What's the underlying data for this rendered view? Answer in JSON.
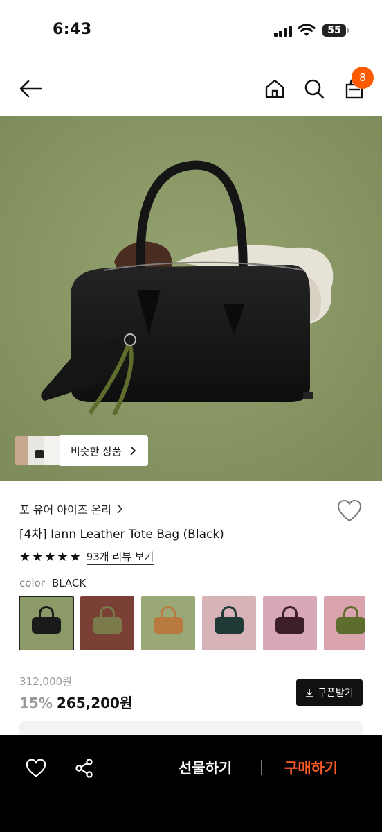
{
  "status_bar": {
    "time": "6:43",
    "battery": "55"
  },
  "header": {
    "back_icon": "arrow-left-icon",
    "home_icon": "home-icon",
    "search_icon": "search-icon",
    "cart_icon": "shopping-bag-icon",
    "cart_count": "8"
  },
  "hero": {
    "similar_label": "비슷한 상품"
  },
  "product": {
    "brand": "포 유어 아이즈 온리",
    "title": "[4차] Iann Leather Tote Bag (Black)",
    "rating_stars": 5,
    "review_link": "93개 리뷰 보기",
    "color_label": "color",
    "color_value": "BLACK",
    "swatches": [
      {
        "color": "#1a1a1a",
        "bg": "#8c9a68"
      },
      {
        "color": "#7a7a4a",
        "bg": "#7a3f35"
      },
      {
        "color": "#b87a3e",
        "bg": "#9aa878"
      },
      {
        "color": "#1f3a36",
        "bg": "#d7b3b7"
      },
      {
        "color": "#3d1f2a",
        "bg": "#d8a8b8"
      },
      {
        "color": "#5e6d2e",
        "bg": "#d9a4ad"
      }
    ],
    "original_price": "312,000원",
    "discount": "15%",
    "price": "265,200원",
    "coupon_label": "쿠폰받기"
  },
  "bottom_bar": {
    "like_icon": "heart-icon",
    "share_icon": "share-icon",
    "gift_label": "선물하기",
    "buy_label": "구매하기"
  },
  "colors": {
    "accent": "#ff5a00",
    "buy": "#ff5a2a",
    "hero_bg": "#8c9a68"
  }
}
